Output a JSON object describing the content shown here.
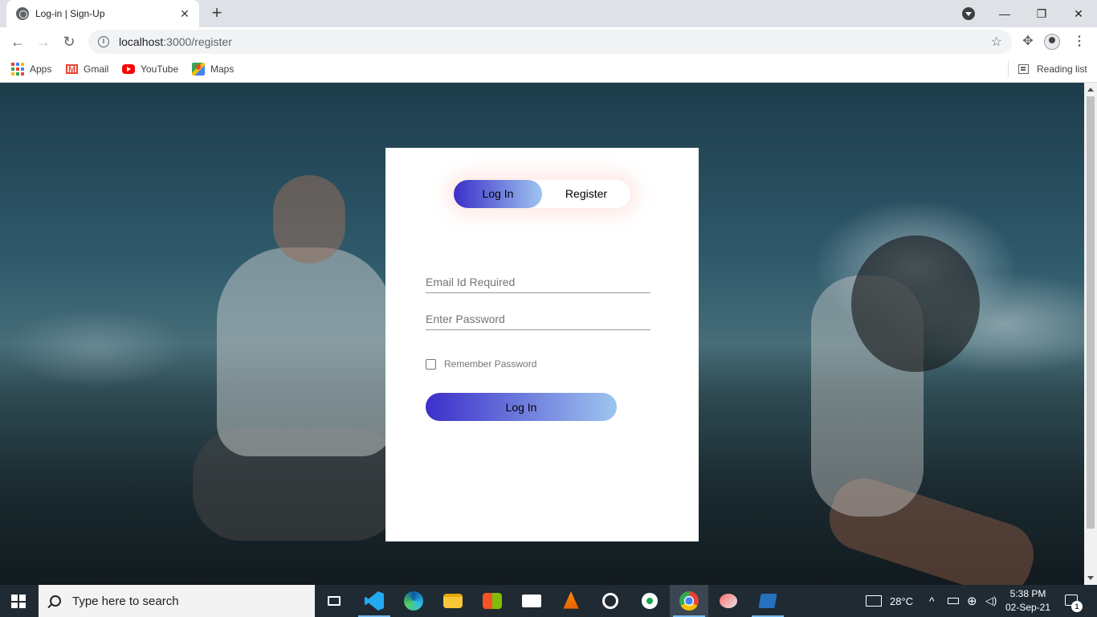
{
  "browser": {
    "tab_title": "Log-in | Sign-Up",
    "tab_close": "✕",
    "new_tab": "+",
    "url_host": "localhost",
    "url_path": ":3000/register",
    "window_controls": {
      "minimize": "—",
      "maximize": "❐",
      "close": "✕"
    }
  },
  "bookmarks": {
    "items": [
      {
        "label": "Apps",
        "icon": "apps-grid-icon"
      },
      {
        "label": "Gmail",
        "icon": "gmail-icon"
      },
      {
        "label": "YouTube",
        "icon": "youtube-icon"
      },
      {
        "label": "Maps",
        "icon": "maps-icon"
      }
    ],
    "reading_list": "Reading list"
  },
  "form": {
    "toggle_login": "Log In",
    "toggle_register": "Register",
    "active_toggle": "Log In",
    "email_placeholder": "Email Id Required",
    "password_placeholder": "Enter Password",
    "remember_label": "Remember Password",
    "submit_label": "Log In",
    "gradient_start": "#3b2fc9",
    "gradient_end": "#9ec5ef"
  },
  "taskbar": {
    "search_placeholder": "Type here to search",
    "weather": "28°C",
    "time": "5:38 PM",
    "date": "02-Sep-21",
    "notification_count": "1",
    "apps": [
      "task-view",
      "vs-code",
      "edge",
      "file-explorer",
      "store",
      "mail",
      "vlc",
      "app",
      "mongodb-compass",
      "chrome",
      "snipping-tool",
      "powershell"
    ]
  }
}
